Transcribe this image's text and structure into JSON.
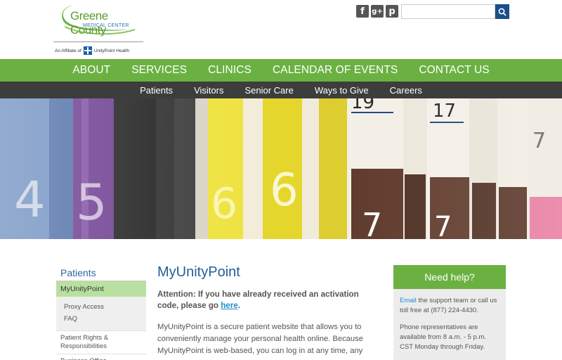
{
  "header": {
    "logo_title": "Greene County",
    "logo_subtitle": "MEDICAL CENTER",
    "affiliate_prefix": "An Affiliate of",
    "affiliate_name": "UnityPoint Health",
    "social": [
      {
        "label": "f",
        "icon": "facebook-icon"
      },
      {
        "label": "g+",
        "icon": "google-plus-icon"
      },
      {
        "label": "p",
        "icon": "pinterest-icon"
      }
    ],
    "search_value": ""
  },
  "nav_main": [
    "ABOUT",
    "SERVICES",
    "CLINICS",
    "CALENDAR OF EVENTS",
    "CONTACT US"
  ],
  "nav_sub": [
    "Patients",
    "Visitors",
    "Senior Care",
    "Ways to Give",
    "Careers"
  ],
  "hero": {
    "folder_labels": [
      "4",
      "5",
      "6",
      "6",
      "19",
      "17",
      "7",
      "7",
      "7"
    ]
  },
  "sidebar": {
    "title": "Patients",
    "active": "MyUnityPoint",
    "subitems": [
      "Proxy Access",
      "FAQ"
    ],
    "items": [
      "Patient Rights & Responsibilities",
      "Business Office"
    ]
  },
  "main": {
    "title": "MyUnityPoint",
    "attention_text": "Attention: If you have already received an activation code, please go",
    "attention_link": "here",
    "attention_end": ".",
    "body": "MyUnityPoint is a secure patient website that allows you to conveniently manage your personal health online.  Because MyUnityPoint is web-based, you can log in at any time, any"
  },
  "help": {
    "title": "Need help?",
    "email_link": "Email",
    "line1": " the support team or call us toll free at (877) 224-4430.",
    "line2": "Phone representatives are available from 8 a.m. - 5 p.m. CST Monday through Friday."
  },
  "colors": {
    "green": "#6bb142",
    "dark_bar": "#3d3d3d",
    "blue_title": "#1f5f97",
    "link": "#1f8ed0"
  }
}
